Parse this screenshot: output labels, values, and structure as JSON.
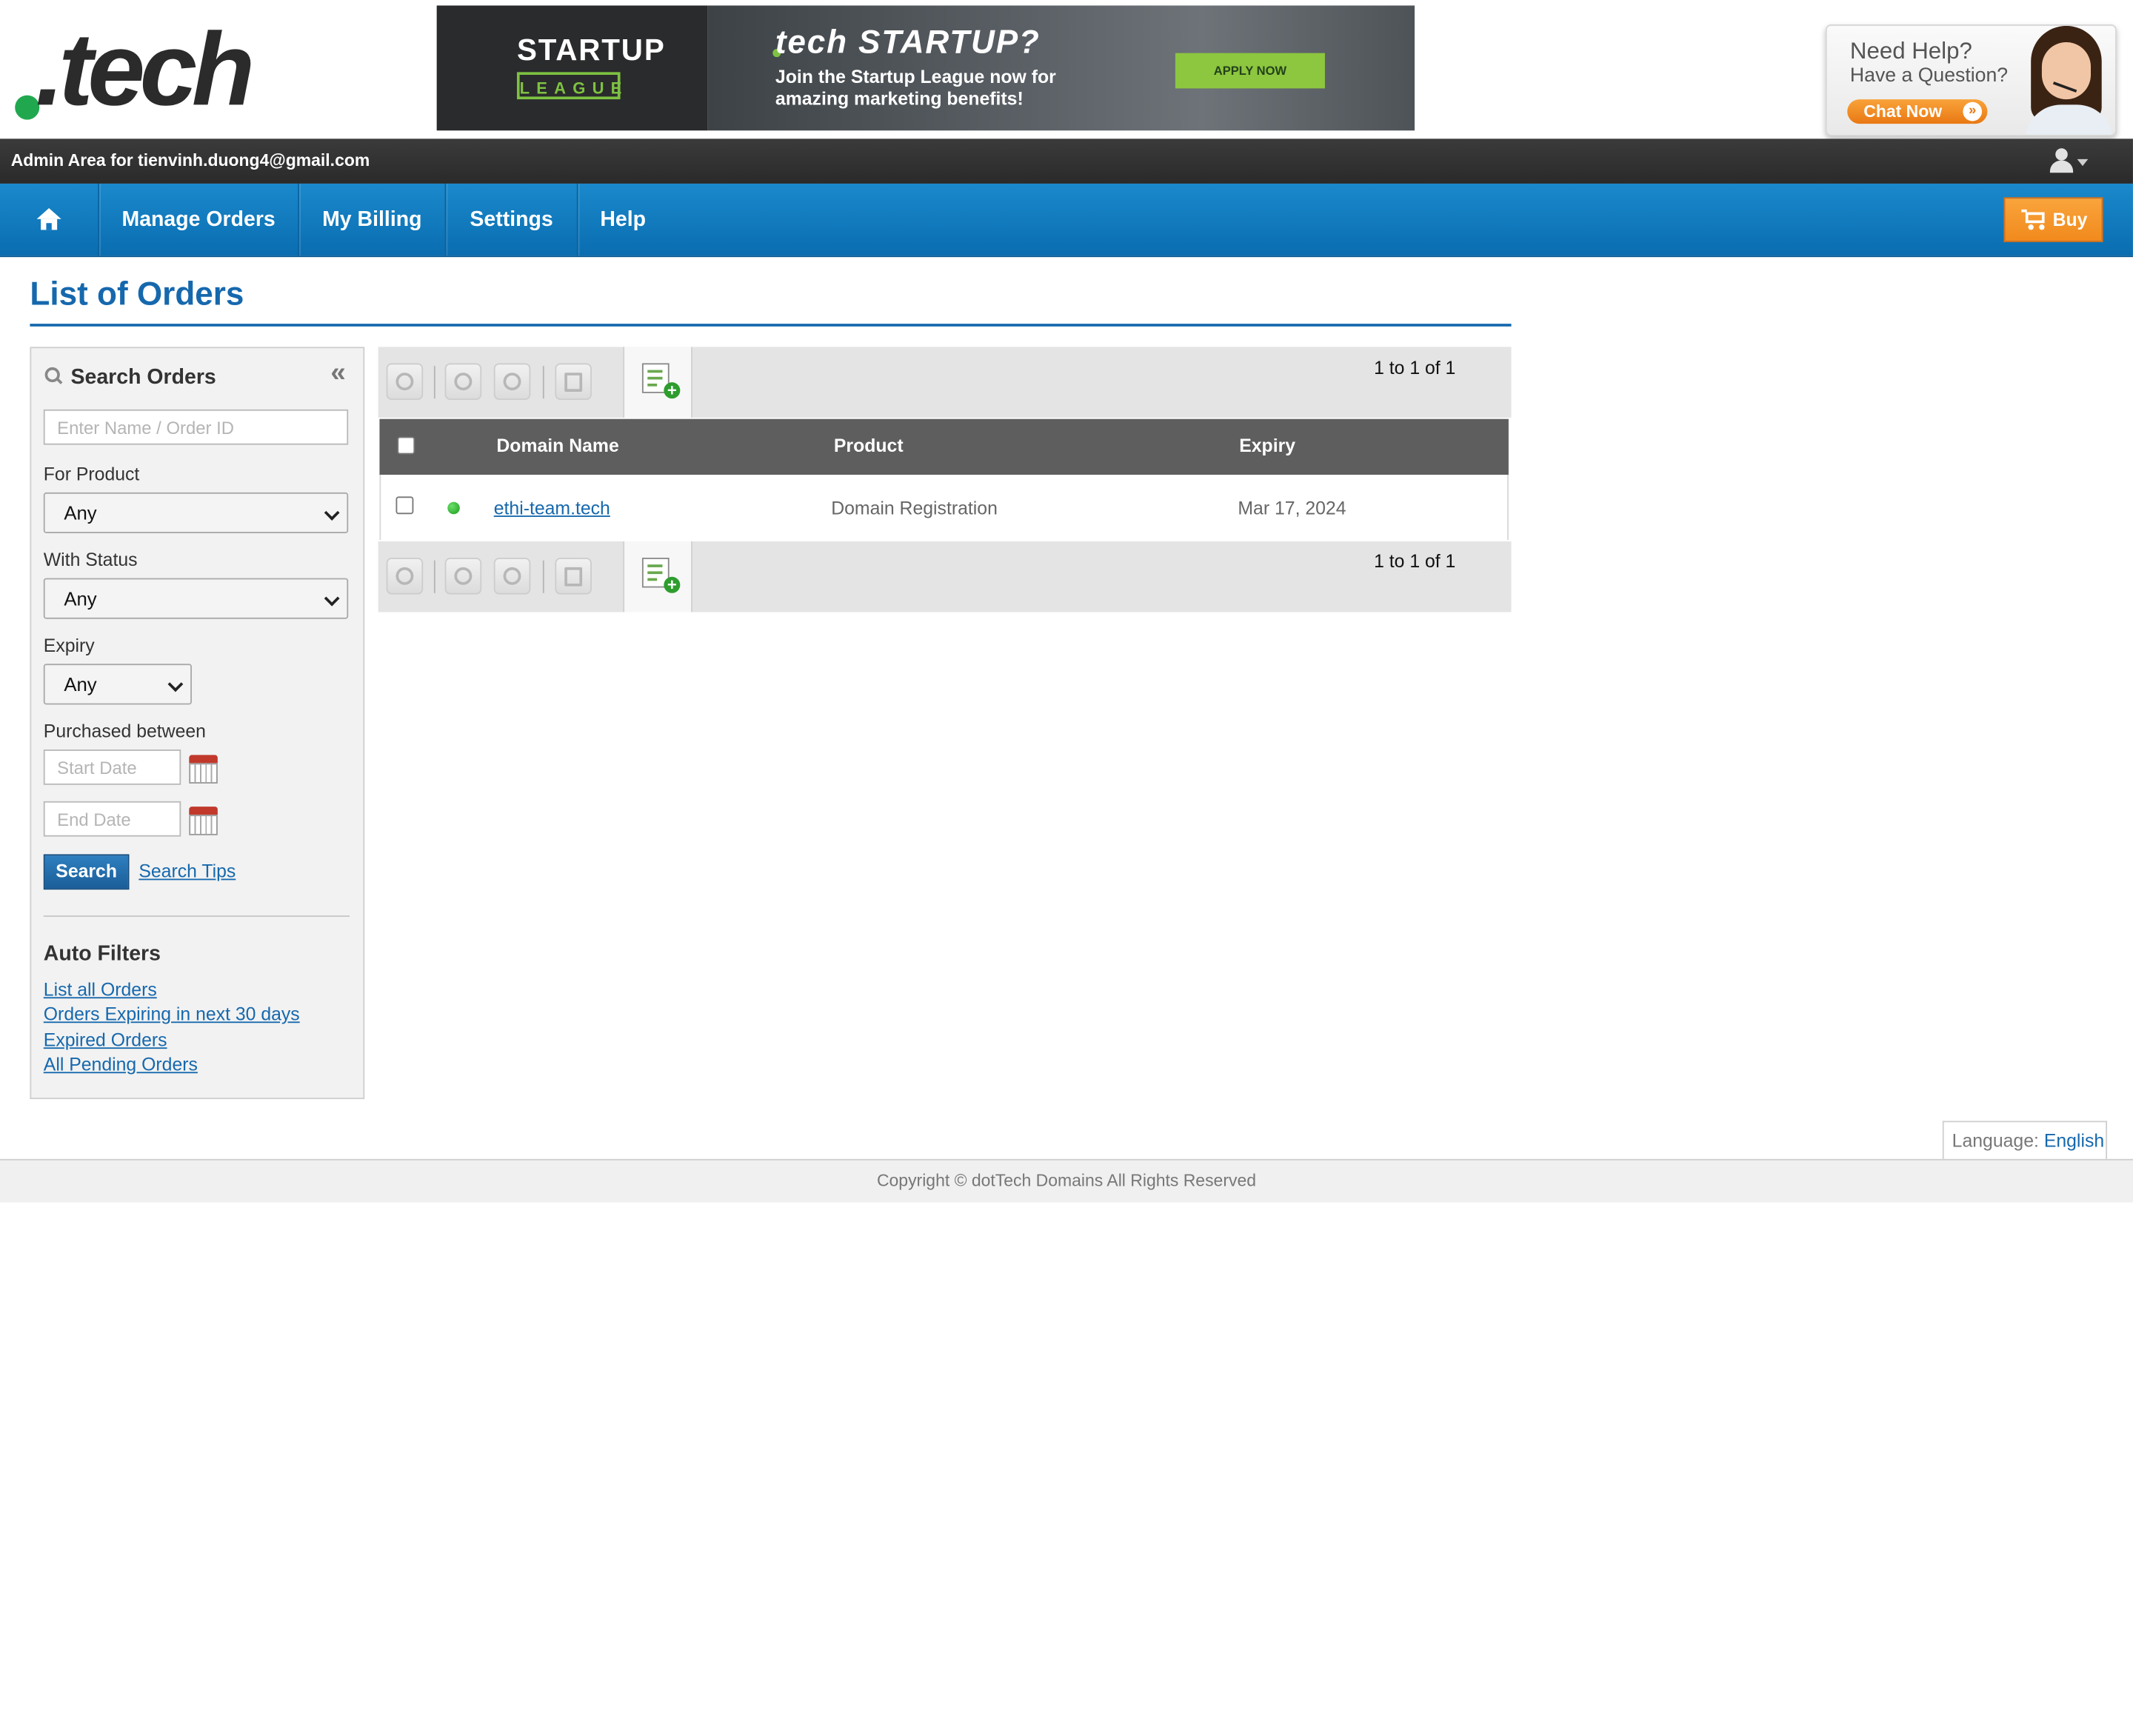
{
  "brand": {
    "logo_text": ".tech",
    "accent_green": "#21a84f"
  },
  "banner": {
    "left_title": "STARTUP",
    "left_subtitle": "LEAGUE",
    "headline": "tech STARTUP?",
    "body": "Join the Startup League now for amazing marketing benefits!",
    "cta": "APPLY NOW"
  },
  "help_widget": {
    "title": "Need Help?",
    "subtitle": "Have a Question?",
    "chat_label": "Chat Now"
  },
  "admin_bar": {
    "text": "Admin Area for tienvinh.duong4@gmail.com",
    "user_icon": "user-icon"
  },
  "nav": {
    "home_icon": "home-icon",
    "items": [
      {
        "label": "Manage Orders"
      },
      {
        "label": "My Billing"
      },
      {
        "label": "Settings"
      },
      {
        "label": "Help"
      }
    ],
    "buy_label": "Buy",
    "colors": {
      "nav_blue": "#0a6db0",
      "buy_orange": "#f18a1d"
    }
  },
  "page": {
    "title": "List of Orders"
  },
  "sidebar": {
    "header": "Search Orders",
    "collapse_glyph": "«",
    "search_placeholder": "Enter Name / Order ID",
    "product_label": "For Product",
    "product_value": "Any",
    "status_label": "With Status",
    "status_value": "Any",
    "expiry_label": "Expiry",
    "expiry_value": "Any",
    "purchased_label": "Purchased between",
    "start_placeholder": "Start Date",
    "end_placeholder": "End Date",
    "search_button": "Search",
    "search_tips": "Search Tips",
    "auto_filters_title": "Auto Filters",
    "auto_filters": [
      {
        "label": "List all Orders"
      },
      {
        "label": "Orders Expiring in next 30 days"
      },
      {
        "label": "Expired Orders"
      },
      {
        "label": "All Pending Orders"
      }
    ]
  },
  "table": {
    "pager_top": "1 to 1 of 1",
    "pager_bottom": "1 to 1 of 1",
    "columns": [
      "Domain Name",
      "Product",
      "Expiry"
    ],
    "rows": [
      {
        "domain": "ethi-team.tech",
        "product": "Domain Registration",
        "expiry": "Mar 17, 2024",
        "status": "active"
      }
    ]
  },
  "footer": {
    "language_label": "Language:",
    "language_value": "English",
    "copyright": "Copyright © dotTech Domains All Rights Reserved"
  }
}
